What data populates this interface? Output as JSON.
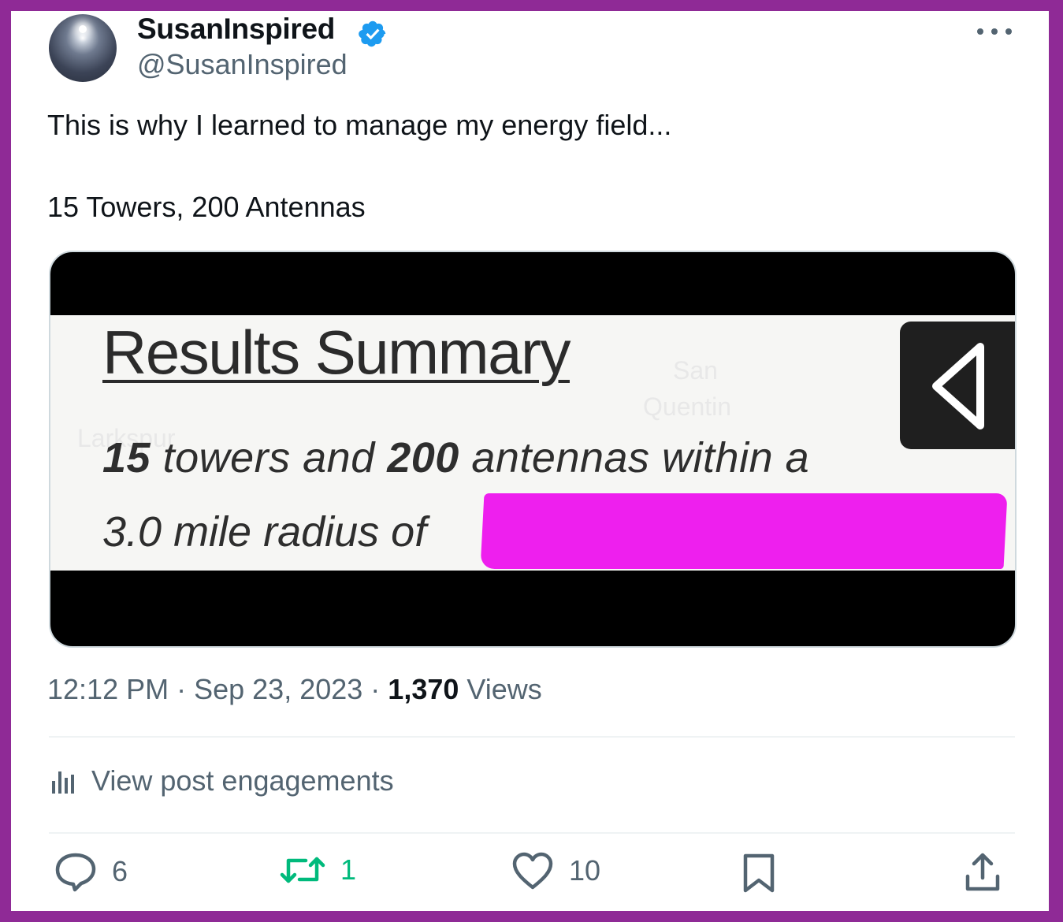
{
  "author": {
    "display_name": "SusanInspired",
    "handle": "@SusanInspired",
    "verified": true
  },
  "tweet": {
    "line1": "This is why I learned to manage my energy field...",
    "line2": "15 Towers, 200 Antennas"
  },
  "media": {
    "title": "Results Summary",
    "line1_num1": "15",
    "line1_mid": " towers and ",
    "line1_num2": "200",
    "line1_end": " antennas within a",
    "line2": "3.0 mile radius of",
    "ghost_text_1": "Larkspur",
    "ghost_text_2": "San",
    "ghost_text_3": "Quentin"
  },
  "meta": {
    "time": "12:12 PM",
    "separator": " · ",
    "date": "Sep 23, 2023",
    "views_count": "1,370",
    "views_label": " Views"
  },
  "engagements": {
    "label": "View post engagements"
  },
  "actions": {
    "replies": "6",
    "retweets": "1",
    "likes": "10"
  },
  "colors": {
    "frame": "#8f2a96",
    "verified": "#1d9bf0",
    "retweet": "#00ba7c",
    "secondary_text": "#536471",
    "redaction": "#ee1fee"
  }
}
